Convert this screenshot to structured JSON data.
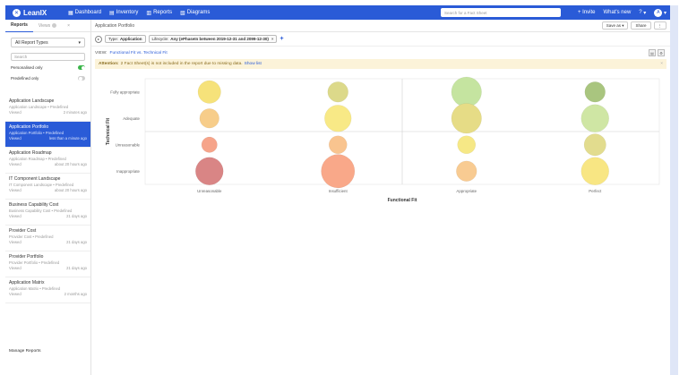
{
  "topbar": {
    "logo": "LeanIX",
    "nav": [
      {
        "icon": "dashboard-icon",
        "glyph": "▦",
        "label": "Dashboard"
      },
      {
        "icon": "inventory-icon",
        "glyph": "▤",
        "label": "Inventory"
      },
      {
        "icon": "reports-icon",
        "glyph": "▥",
        "label": "Reports"
      },
      {
        "icon": "diagrams-icon",
        "glyph": "▧",
        "label": "Diagrams"
      }
    ],
    "search_placeholder": "Search for a Fact Sheet",
    "invite_label": "+ Invite",
    "whats_new_label": "What's new",
    "help_label": "?",
    "avatar_label": "A"
  },
  "sidebar": {
    "tabs": [
      "Reports",
      "Views"
    ],
    "close": "×",
    "report_type_select": "All Report Types",
    "search_placeholder": "Search",
    "toggles": [
      {
        "label": "Personalised only",
        "on": true
      },
      {
        "label": "Predefined only",
        "on": false
      }
    ],
    "reports": [
      {
        "title": "Application Landscape",
        "subtitle": "Application Landscape • Predefined",
        "status": "Viewed",
        "time": "2 minutes ago",
        "active": false
      },
      {
        "title": "Application Portfolio",
        "subtitle": "Application Portfolio • Predefined",
        "status": "Viewed",
        "time": "less than a minute ago",
        "active": true
      },
      {
        "title": "Application Roadmap",
        "subtitle": "Application Roadmap • Predefined",
        "status": "Viewed",
        "time": "about 20 hours ago",
        "active": false
      },
      {
        "title": "IT Component Landscape",
        "subtitle": "IT Component Landscape • Predefined",
        "status": "Viewed",
        "time": "about 20 hours ago",
        "active": false
      },
      {
        "title": "Business Capability Cost",
        "subtitle": "Business Capability Cost • Predefined",
        "status": "Viewed",
        "time": "21 days ago",
        "active": false
      },
      {
        "title": "Provider Cost",
        "subtitle": "Provider Cost • Predefined",
        "status": "Viewed",
        "time": "21 days ago",
        "active": false
      },
      {
        "title": "Provider Portfolio",
        "subtitle": "Provider Portfolio • Predefined",
        "status": "Viewed",
        "time": "21 days ago",
        "active": false
      },
      {
        "title": "Application Matrix",
        "subtitle": "Application Matrix • Predefined",
        "status": "Viewed",
        "time": "2 months ago",
        "active": false
      }
    ],
    "manage_label": "Manage Reports"
  },
  "main": {
    "breadcrumb": "Application Portfolio",
    "save_as_label": "Save as",
    "share_label": "Share",
    "more_label": "⋮",
    "filter_type_label": "Type:",
    "filter_type_value": "Application",
    "filter_lifecycle_label": "Lifecycle:",
    "filter_lifecycle_value": "Any (ePhaseIn between 2019-12-31 and 2099-12-30)",
    "filter_remove": "×",
    "filter_add": "+",
    "view_label": "VIEW:",
    "view_value": "Functional Fit vs. Technical Fit",
    "view_icons": [
      "▤",
      "⚙"
    ],
    "alert_strong": "Attention:",
    "alert_text": "2 Fact Sheet(s) is not included in the report due to missing data.",
    "alert_link": "Show list",
    "alert_close": "×"
  },
  "chart_data": {
    "type": "scatter",
    "xlabel": "Functional Fit",
    "ylabel": "Technical Fit",
    "x_categories": [
      "Unreasonable",
      "Insufficient",
      "Appropriate",
      "Perfect"
    ],
    "y_categories": [
      "Fully appropriate",
      "Adequate",
      "Unreasonable",
      "Inappropriate"
    ],
    "points": [
      {
        "x": "Unreasonable",
        "y": "Fully appropriate",
        "size": 2.5,
        "color": "#f6e27a"
      },
      {
        "x": "Insufficient",
        "y": "Fully appropriate",
        "size": 2.0,
        "color": "#dcd98a"
      },
      {
        "x": "Appropriate",
        "y": "Fully appropriate",
        "size": 4.0,
        "color": "#c5e4a0"
      },
      {
        "x": "Perfect",
        "y": "Fully appropriate",
        "size": 2.0,
        "color": "#a9c57f"
      },
      {
        "x": "Unreasonable",
        "y": "Adequate",
        "size": 1.8,
        "color": "#f7cd8a"
      },
      {
        "x": "Insufficient",
        "y": "Adequate",
        "size": 3.3,
        "color": "#f8e986"
      },
      {
        "x": "Appropriate",
        "y": "Adequate",
        "size": 4.0,
        "color": "#e6dc86"
      },
      {
        "x": "Perfect",
        "y": "Adequate",
        "size": 3.5,
        "color": "#cfe6a4"
      },
      {
        "x": "Unreasonable",
        "y": "Unreasonable",
        "size": 1.0,
        "color": "#f6a48a"
      },
      {
        "x": "Insufficient",
        "y": "Unreasonable",
        "size": 1.5,
        "color": "#f9c48f"
      },
      {
        "x": "Appropriate",
        "y": "Unreasonable",
        "size": 1.5,
        "color": "#f6e886"
      },
      {
        "x": "Perfect",
        "y": "Unreasonable",
        "size": 2.3,
        "color": "#e2dc8e"
      },
      {
        "x": "Unreasonable",
        "y": "Inappropriate",
        "size": 3.5,
        "color": "#d98585"
      },
      {
        "x": "Insufficient",
        "y": "Inappropriate",
        "size": 4.7,
        "color": "#f9a889"
      },
      {
        "x": "Appropriate",
        "y": "Inappropriate",
        "size": 2.0,
        "color": "#f8cb92"
      },
      {
        "x": "Perfect",
        "y": "Inappropriate",
        "size": 3.5,
        "color": "#f8e683"
      }
    ],
    "grid": true,
    "colors": {
      "accent": "#2a5bd7",
      "grid": "#e4e4e4"
    }
  }
}
